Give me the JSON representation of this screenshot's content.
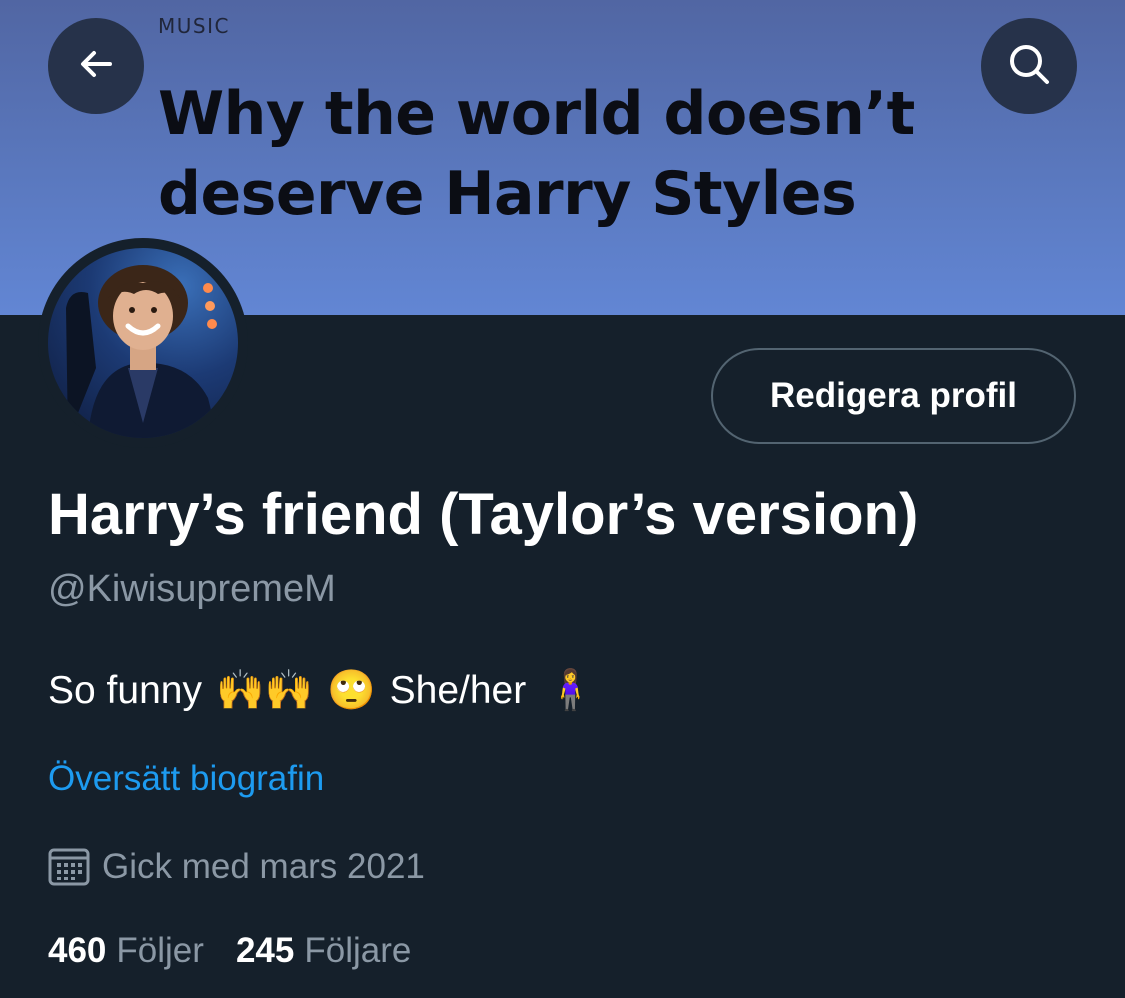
{
  "banner": {
    "kicker": "MUSIC",
    "headline": "Why the world doesn’t deserve Harry Styles",
    "background_color": "#5a78be"
  },
  "nav": {
    "back_icon": "arrow-left-icon",
    "search_icon": "search-icon"
  },
  "profile": {
    "edit_label": "Redigera profil",
    "display_name": "Harry’s friend (Taylor’s version)",
    "handle": "@KiwisupremeM",
    "bio": {
      "text_start": "So funny",
      "emojis_1": "🙌🙌",
      "emoji_2": "🙄",
      "pronouns": "She/her",
      "emoji_3": "🧍‍♀️"
    },
    "translate_label": "Översätt biografin",
    "joined_icon": "calendar-icon",
    "joined_label": "Gick med mars 2021",
    "following_count": "460",
    "following_label": "Följer",
    "followers_count": "245",
    "followers_label": "Följare"
  },
  "colors": {
    "background": "#15202b",
    "link": "#1d9bf0",
    "secondary_text": "#8b98a5"
  }
}
